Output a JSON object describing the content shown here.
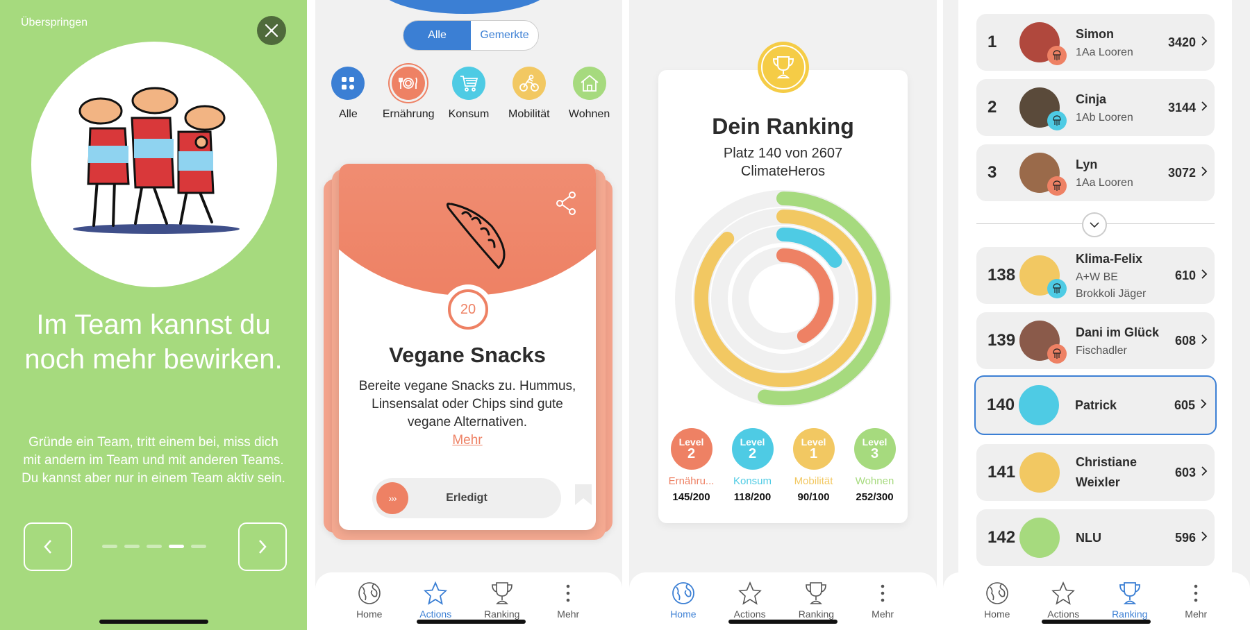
{
  "colors": {
    "green": "#a6da7e",
    "blue": "#3b7fd4",
    "red": "#ee8164",
    "cyan": "#4ecbe4",
    "yellow": "#f2c862",
    "grey": "#f1f1f1"
  },
  "onboarding": {
    "skip_label": "Überspringen",
    "close_icon": "close-icon",
    "illustration": "three-team-figures",
    "headline": "Im Team kannst du noch mehr bewirken.",
    "body": "Gründe ein Team, tritt einem bei, miss dich mit andern im Team und mit anderen Teams. Du kannst aber nur in einem Team aktiv sein.",
    "page_count": 5,
    "current_page": 4
  },
  "actions": {
    "segments": [
      {
        "label": "Alle",
        "active": true
      },
      {
        "label": "Gemerkte",
        "active": false
      }
    ],
    "categories": [
      {
        "label": "Alle",
        "icon": "grid-icon"
      },
      {
        "label": "Ernährung",
        "icon": "plate-icon",
        "selected": true
      },
      {
        "label": "Konsum",
        "icon": "cart-icon"
      },
      {
        "label": "Mobilität",
        "icon": "bike-icon"
      },
      {
        "label": "Wohnen",
        "icon": "house-icon"
      }
    ],
    "card": {
      "points": "20",
      "title": "Vegane Snacks",
      "description": "Bereite vegane Snacks zu. Hummus, Linsensalat oder Chips sind gute vegane Alternativen.",
      "more_link": "Mehr",
      "done_label": "Erledigt",
      "icon": "pea-pod-icon"
    }
  },
  "tabbar": [
    {
      "label": "Home",
      "icon": "globe-icon"
    },
    {
      "label": "Actions",
      "icon": "star-icon"
    },
    {
      "label": "Ranking",
      "icon": "trophy-icon"
    },
    {
      "label": "Mehr",
      "icon": "more-icon"
    }
  ],
  "ranking_summary": {
    "title": "Dein Ranking",
    "subtitle_line1": "Platz 140 von 2607",
    "subtitle_line2": "ClimateHeros",
    "level_word": "Level",
    "categories": [
      {
        "name": "Ernähru...",
        "level": "2",
        "score": "145/200",
        "fill": 0.42
      },
      {
        "name": "Konsum",
        "level": "2",
        "score": "118/200",
        "fill": 0.15
      },
      {
        "name": "Mobilität",
        "level": "1",
        "score": "90/100",
        "fill": 0.88
      },
      {
        "name": "Wohnen",
        "level": "3",
        "score": "252/300",
        "fill": 0.53
      }
    ]
  },
  "leaderboard": {
    "top": [
      {
        "rank": "1",
        "name": "Simon",
        "team": "1Aa Looren",
        "score": "3420",
        "badge": "jellyfish"
      },
      {
        "rank": "2",
        "name": "Cinja",
        "team": "1Ab Looren",
        "score": "3144",
        "badge": "penguin"
      },
      {
        "rank": "3",
        "name": "Lyn",
        "team": "1Aa Looren",
        "score": "3072",
        "badge": "jellyfish"
      }
    ],
    "around_me": [
      {
        "rank": "138",
        "name": "Klima-Felix",
        "team": "A+W BE",
        "title": "Brokkoli Jäger",
        "score": "610",
        "badge": "penguin"
      },
      {
        "rank": "139",
        "name": "Dani im Glück",
        "team": "",
        "title": "Fischadler",
        "score": "608",
        "badge": "fish"
      },
      {
        "rank": "140",
        "name": "Patrick",
        "team": "",
        "title": "",
        "score": "605",
        "me": true
      },
      {
        "rank": "141",
        "name": "Christiane Weixler",
        "team": "",
        "title": "",
        "score": "603"
      },
      {
        "rank": "142",
        "name": "NLU",
        "team": "",
        "title": "",
        "score": "596"
      }
    ]
  }
}
